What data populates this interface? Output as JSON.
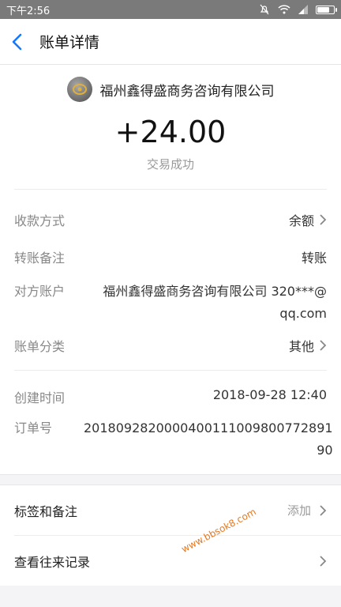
{
  "status_bar": {
    "time": "下午2:56"
  },
  "nav": {
    "title": "账单详情"
  },
  "summary": {
    "merchant": "福州鑫得盛商务咨询有限公司",
    "amount": "+24.00",
    "status": "交易成功"
  },
  "details": {
    "payment_method": {
      "label": "收款方式",
      "value": "余额"
    },
    "transfer_note": {
      "label": "转账备注",
      "value": "转账"
    },
    "counterparty": {
      "label": "对方账户",
      "value_line1": "福州鑫得盛商务咨询有限公司 320***@",
      "value_line2": "qq.com"
    },
    "category": {
      "label": "账单分类",
      "value": "其他"
    },
    "created_time": {
      "label": "创建时间",
      "value": "2018-09-28 12:40"
    },
    "order_no": {
      "label": "订单号",
      "value_line1": "2018092820000400111009800772891",
      "value_line2": "90"
    }
  },
  "actions": {
    "tags": {
      "label": "标签和备注",
      "hint": "添加"
    },
    "history": {
      "label": "查看往来记录"
    }
  },
  "watermark": "www.bbsok8.com"
}
